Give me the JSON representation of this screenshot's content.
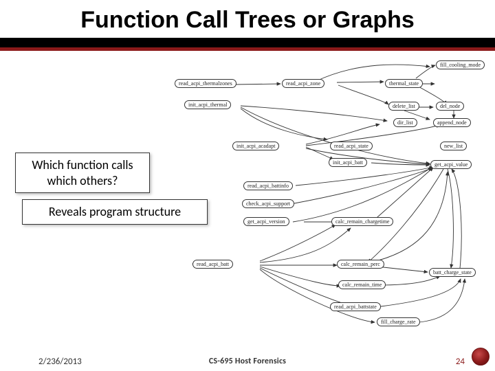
{
  "title": "Function Call Trees or Graphs",
  "callouts": {
    "q1_line1": "Which function calls",
    "q1_line2": "which others?",
    "q2": "Reveals program structure"
  },
  "footer": {
    "date": "2/236/2013",
    "course": "CS-695 Host Forensics",
    "page": "24"
  },
  "graph": {
    "nodes": {
      "read_acpi_thermalzones": "read_acpi_thermalzones",
      "init_acpi_thermal": "init_acpi_thermal",
      "fill_cooling_mode": "fill_cooling_mode",
      "read_acpi_zone": "read_acpi_zone",
      "thermal_state": "thermal_state",
      "delete_list": "delete_list",
      "del_node": "del_node",
      "dir_list": "dir_list",
      "append_node": "append_node",
      "init_acpi_acadapt": "init_acpi_acadapt",
      "read_acpi_state": "read_acpi_state",
      "new_list": "new_list",
      "read_acpi_battinfo": "read_acpi_battinfo",
      "get_acpi_version": "get_acpi_version",
      "get_acpi_value": "get_acpi_value",
      "check_acpi_support": "check_acpi_support",
      "calc_remain_perc": "calc_remain_perc",
      "init_acpi_batt": "init_acpi_batt",
      "read_acpi_batt": "read_acpi_batt",
      "batt_charge_state": "batt_charge_state",
      "calc_remain_chargetime": "calc_remain_chargetime",
      "fill_charge_rate": "fill_charge_rate",
      "calc_remain_time": "calc_remain_time",
      "read_acpi_battstate": "read_acpi_battstate"
    }
  }
}
